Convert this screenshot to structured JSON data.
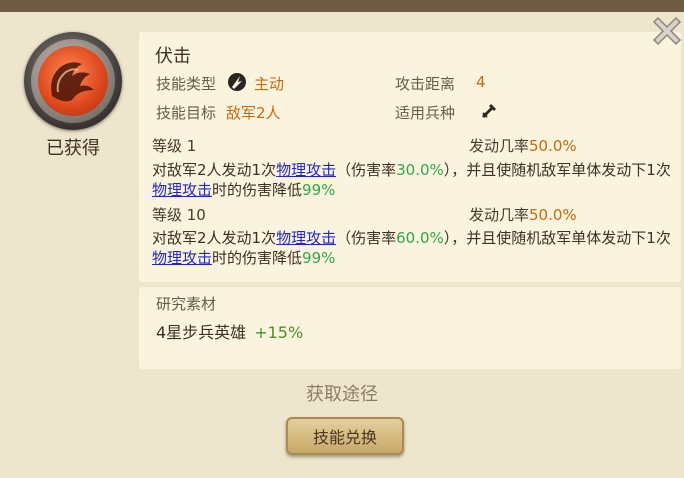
{
  "skill": {
    "name": "伏击",
    "status": "已获得",
    "type_label": "技能类型",
    "type_value": "主动",
    "range_label": "攻击距离",
    "range_value": "4",
    "target_label": "技能目标",
    "target_value": "敌军2人",
    "troop_label": "适用兵种"
  },
  "levels": [
    {
      "level_text": "等级 1",
      "rate_label": "发动几率",
      "rate_value": "50.0%",
      "desc_a": "对敌军2人发动1次",
      "link_a": "物理攻击",
      "desc_b": "（伤害率",
      "dmg_rate": "30.0%",
      "desc_c": "），并且使随机敌军单体发动下1次",
      "link_b": "物理攻击",
      "desc_d": "时的伤害降低",
      "reduce": "99%"
    },
    {
      "level_text": "等级 10",
      "rate_label": "发动几率",
      "rate_value": "50.0%",
      "desc_a": "对敌军2人发动1次",
      "link_a": "物理攻击",
      "desc_b": "（伤害率",
      "dmg_rate": "60.0%",
      "desc_c": "），并且使随机敌军单体发动下1次",
      "link_b": "物理攻击",
      "desc_d": "时的伤害降低",
      "reduce": "99%"
    }
  ],
  "materials": {
    "title": "研究素材",
    "item": "4星步兵英雄",
    "bonus": "+15%"
  },
  "acquire_title": "获取途径",
  "exchange_button": "技能兑换",
  "icons": {
    "skill": "ambush-skill-icon",
    "type": "active-skill-icon",
    "troop": "infantry-icon",
    "close": "close-icon"
  },
  "colors": {
    "accent_orange": "#c9690d",
    "link_blue": "#2226c8",
    "value_green": "#2ea84a"
  }
}
